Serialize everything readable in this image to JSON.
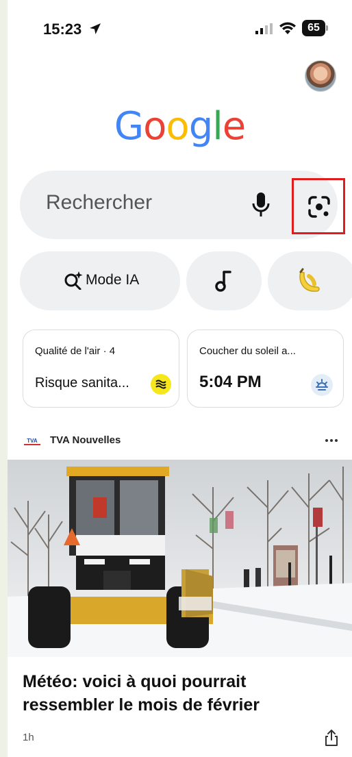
{
  "status_bar": {
    "time": "15:23",
    "battery": "65"
  },
  "logo": {
    "letters": [
      "G",
      "o",
      "o",
      "g",
      "l",
      "e"
    ],
    "colors": [
      "#4285F4",
      "#EA4335",
      "#FBBC05",
      "#4285F4",
      "#34A853",
      "#EA4335"
    ]
  },
  "search": {
    "placeholder": "Rechercher"
  },
  "chips": {
    "ai_mode_label": "Mode IA"
  },
  "cards": {
    "air": {
      "title": "Qualité de l'air · 4",
      "value": "Risque sanita..."
    },
    "sunset": {
      "title": "Coucher du soleil a...",
      "value": "5:04 PM"
    }
  },
  "article": {
    "source_logo": "TVA",
    "source_name": "TVA Nouvelles",
    "headline": "Météo: voici à quoi pourrait ressembler le mois de février",
    "age": "1h"
  },
  "colors": {
    "accent_highlight": "#e01c1c",
    "air_badge": "#f5e71b"
  },
  "icons": [
    "location-arrow-icon",
    "signal-icon",
    "wifi-icon",
    "mic-icon",
    "lens-camera-icon",
    "ai-sparkle-search-icon",
    "music-note-icon",
    "banana-icon",
    "air-quality-icon",
    "sunset-icon",
    "more-dots-icon",
    "share-icon"
  ]
}
